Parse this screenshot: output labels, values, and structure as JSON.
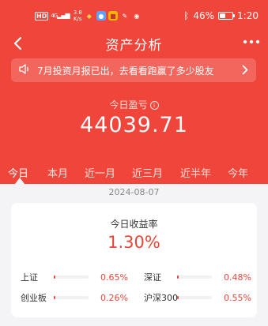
{
  "status_bar": {
    "network": "HD",
    "signal": "4G",
    "speed_value": "3.8",
    "speed_unit": "K/s",
    "battery": "46%",
    "time": "1:20"
  },
  "nav": {
    "back_icon": "chevron-left-icon",
    "title": "资产分析",
    "more_icon": "more-dots-icon"
  },
  "banner": {
    "icon": "speaker-icon",
    "text": "7月投资月报已出，去看看跑赢了多少股友"
  },
  "profit": {
    "label": "今日盈亏",
    "value": "44039.71"
  },
  "tabs": [
    "今日",
    "本月",
    "近一月",
    "近三月",
    "近半年",
    "今年"
  ],
  "active_tab": 0,
  "date": "2024-08-07",
  "card": {
    "title": "今日收益率",
    "rate": "1.30%",
    "indices": [
      {
        "label": "上证",
        "value": "0.65%",
        "fill": 0.05
      },
      {
        "label": "深证",
        "value": "0.48%",
        "fill": 0.04
      },
      {
        "label": "创业板",
        "value": "0.26%",
        "fill": 0.03
      },
      {
        "label": "沪深300",
        "value": "0.55%",
        "fill": 0.04
      }
    ]
  },
  "colors": {
    "brand": "#f0453a",
    "accent_text": "#e8453a"
  }
}
